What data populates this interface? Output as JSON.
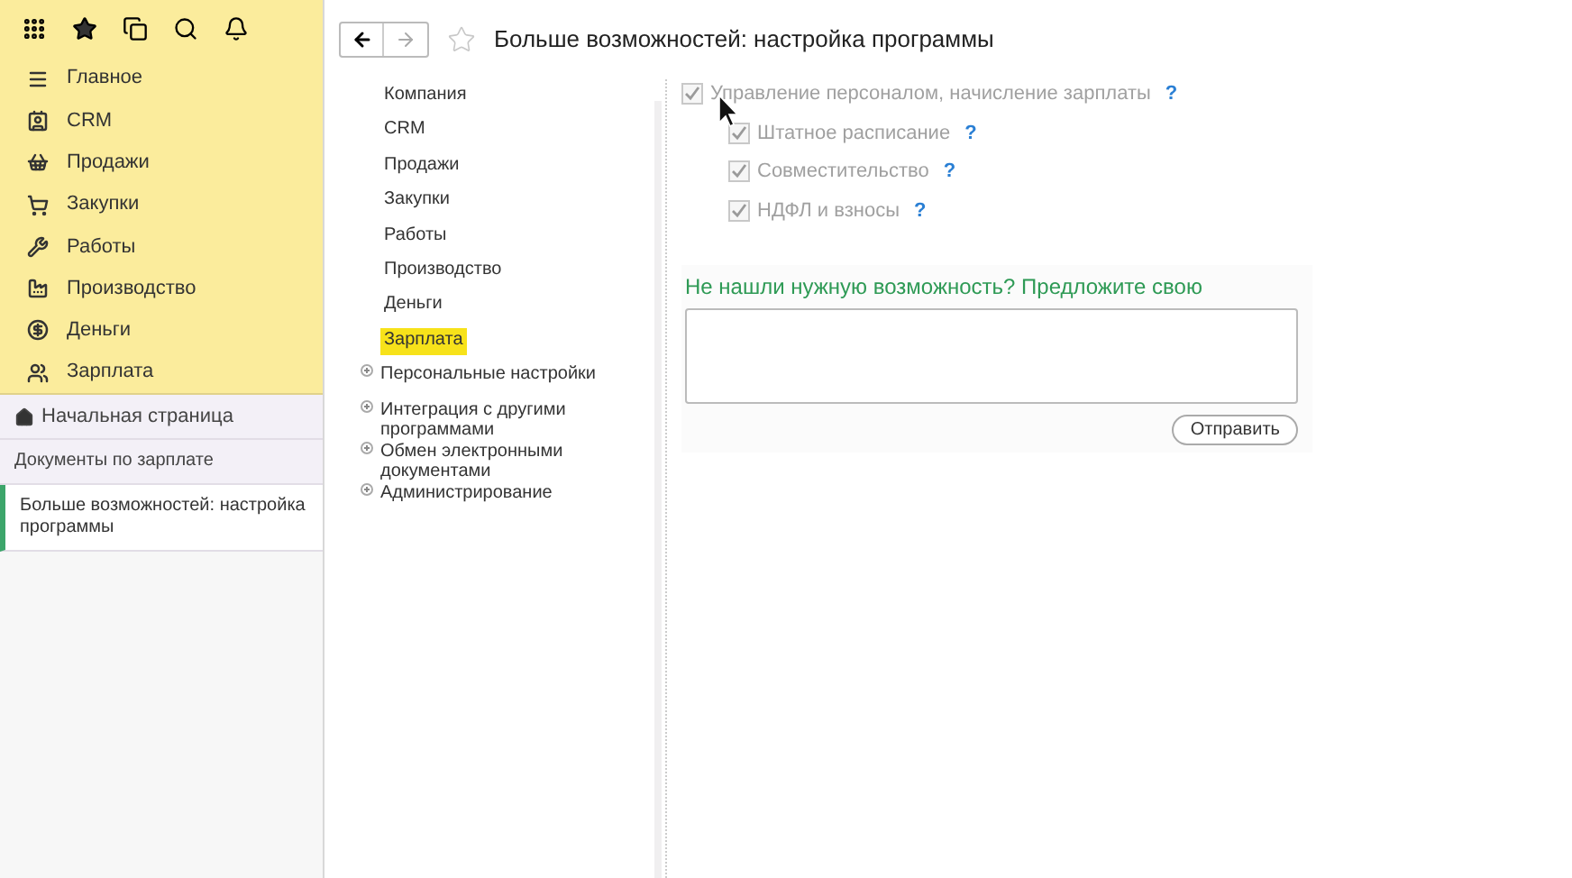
{
  "sidebar": {
    "sections": [
      {
        "label": "Главное"
      },
      {
        "label": "CRM"
      },
      {
        "label": "Продажи"
      },
      {
        "label": "Закупки"
      },
      {
        "label": "Работы"
      },
      {
        "label": "Производство"
      },
      {
        "label": "Деньги"
      },
      {
        "label": "Зарплата"
      }
    ],
    "open_windows": [
      {
        "label": "Начальная страница",
        "kind": "home",
        "selected": false
      },
      {
        "label": "Документы по зарплате",
        "kind": "page",
        "selected": false
      },
      {
        "label": "Больше возможностей: настройка программы",
        "kind": "page",
        "selected": true
      }
    ]
  },
  "header": {
    "title": "Больше возможностей: настройка программы"
  },
  "tree": [
    {
      "label": "Компания",
      "selected": false
    },
    {
      "label": "CRM",
      "selected": false
    },
    {
      "label": "Продажи",
      "selected": false
    },
    {
      "label": "Закупки",
      "selected": false
    },
    {
      "label": "Работы",
      "selected": false
    },
    {
      "label": "Производство",
      "selected": false
    },
    {
      "label": "Деньги",
      "selected": false
    },
    {
      "label": "Зарплата",
      "selected": true
    },
    {
      "label": "Персональные настройки",
      "selected": false,
      "expanded": false
    },
    {
      "label": "Интеграция с другими программами",
      "selected": false,
      "expanded": false
    },
    {
      "label": "Обмен электронными документами",
      "selected": false,
      "expanded": false
    },
    {
      "label": "Администрирование",
      "selected": false,
      "expanded": false
    }
  ],
  "options": [
    {
      "label": "Управление персоналом, начисление зарплаты",
      "help": "?",
      "checked": true,
      "disabled": true,
      "children": [
        {
          "label": "Штатное расписание",
          "help": "?",
          "checked": true,
          "disabled": true
        },
        {
          "label": "Совместительство",
          "help": "?",
          "checked": true,
          "disabled": true
        },
        {
          "label": "НДФЛ и взносы",
          "help": "?",
          "checked": true,
          "disabled": true
        }
      ]
    }
  ],
  "suggestion": {
    "title": "Не нашли нужную возможность? Предложите свою",
    "button": "Отправить"
  }
}
